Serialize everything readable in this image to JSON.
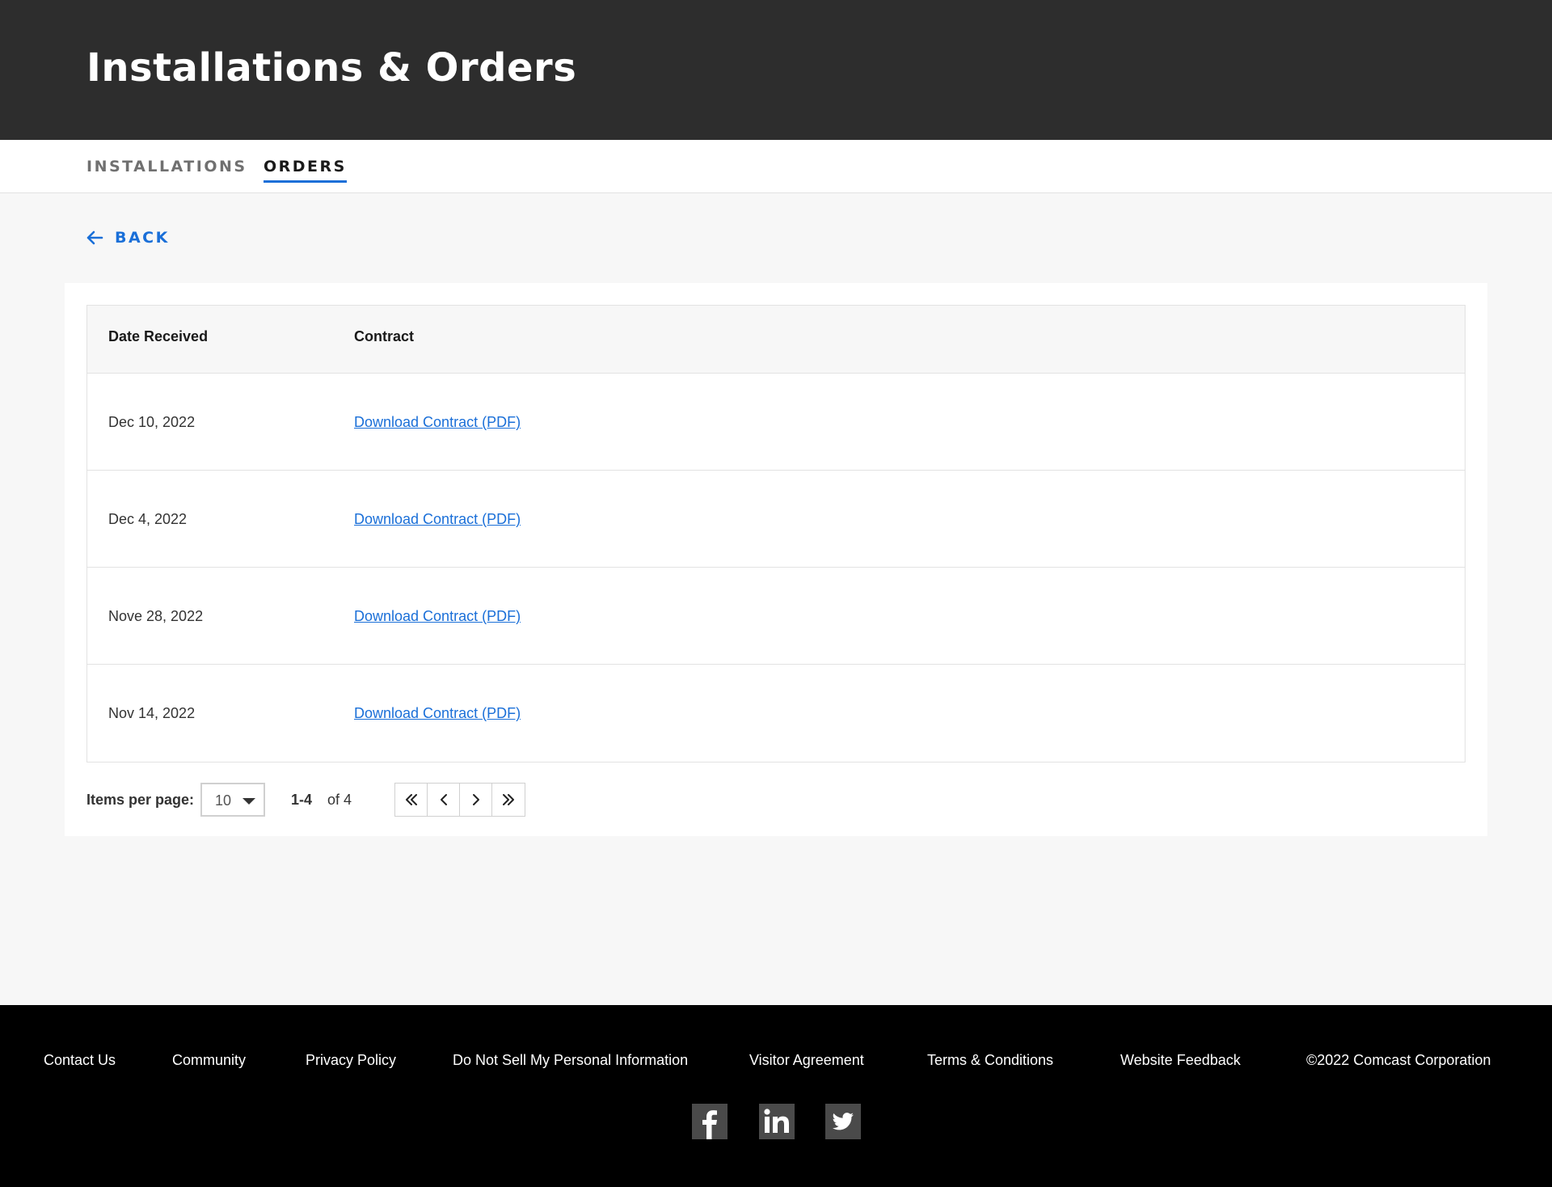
{
  "header": {
    "title": "Installations & Orders"
  },
  "tabs": [
    {
      "label": "INSTALLATIONS",
      "active": false
    },
    {
      "label": "ORDERS",
      "active": true
    }
  ],
  "back": {
    "label": "BACK"
  },
  "table": {
    "columns": [
      "Date Received",
      "Contract"
    ],
    "rows": [
      {
        "date": "Dec 10, 2022",
        "link": "Download Contract (PDF)"
      },
      {
        "date": "Dec 4, 2022",
        "link": "Download Contract (PDF)"
      },
      {
        "date": "Nove 28, 2022",
        "link": "Download Contract (PDF)"
      },
      {
        "date": "Nov 14, 2022",
        "link": "Download Contract (PDF)"
      }
    ]
  },
  "pagination": {
    "items_per_page_label": "Items per page:",
    "items_per_page_value": "10",
    "range": "1-4",
    "of_total": "of 4",
    "buttons": [
      "first-page-icon",
      "prev-page-icon",
      "next-page-icon",
      "last-page-icon"
    ]
  },
  "footer": {
    "links": [
      "Contact Us",
      "Community",
      "Privacy Policy",
      "Do Not Sell My Personal Information",
      "Visitor Agreement",
      "Terms & Conditions",
      "Website Feedback"
    ],
    "copyright": "©2022 Comcast Corporation",
    "social": [
      "facebook-icon",
      "linkedin-icon",
      "twitter-icon"
    ]
  },
  "colors": {
    "header_bg": "#2d2d2d",
    "accent_blue": "#1a6fd8",
    "page_bg": "#f7f7f7",
    "footer_bg": "#000000"
  }
}
